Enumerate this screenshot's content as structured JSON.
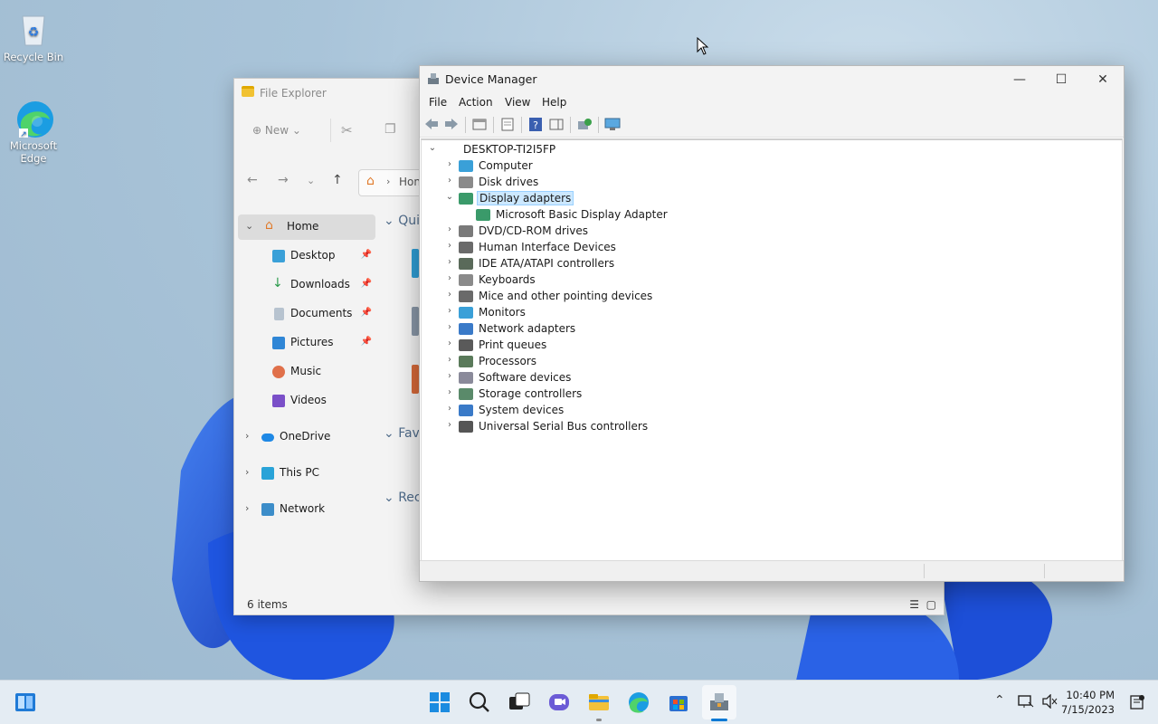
{
  "desktop": {
    "icons": [
      {
        "label": "Recycle Bin"
      },
      {
        "label": "Microsoft Edge"
      }
    ]
  },
  "file_explorer": {
    "title": "File Explorer",
    "new_label": "New",
    "address_text": "Hon",
    "sidebar": [
      {
        "label": "Home",
        "selected": true
      },
      {
        "label": "Desktop"
      },
      {
        "label": "Downloads"
      },
      {
        "label": "Documents"
      },
      {
        "label": "Pictures"
      },
      {
        "label": "Music"
      },
      {
        "label": "Videos"
      },
      {
        "label": "OneDrive"
      },
      {
        "label": "This PC"
      },
      {
        "label": "Network"
      }
    ],
    "sections": [
      "Qui",
      "Favo",
      "Rec"
    ],
    "status": "6 items"
  },
  "device_manager": {
    "title": "Device Manager",
    "menu": [
      "File",
      "Action",
      "View",
      "Help"
    ],
    "root": "DESKTOP-TI2I5FP",
    "categories": [
      {
        "label": "Computer"
      },
      {
        "label": "Disk drives"
      },
      {
        "label": "Display adapters",
        "expanded": true,
        "selected": true
      },
      {
        "label": "Microsoft Basic Display Adapter",
        "child": true
      },
      {
        "label": "DVD/CD-ROM drives"
      },
      {
        "label": "Human Interface Devices"
      },
      {
        "label": "IDE ATA/ATAPI controllers"
      },
      {
        "label": "Keyboards"
      },
      {
        "label": "Mice and other pointing devices"
      },
      {
        "label": "Monitors"
      },
      {
        "label": "Network adapters"
      },
      {
        "label": "Print queues"
      },
      {
        "label": "Processors"
      },
      {
        "label": "Software devices"
      },
      {
        "label": "Storage controllers"
      },
      {
        "label": "System devices"
      },
      {
        "label": "Universal Serial Bus controllers"
      }
    ]
  },
  "taskbar": {
    "time": "10:40 PM",
    "date": "7/15/2023"
  },
  "colors": {
    "accent": "#0078d4",
    "selection": "#cce8ff"
  }
}
